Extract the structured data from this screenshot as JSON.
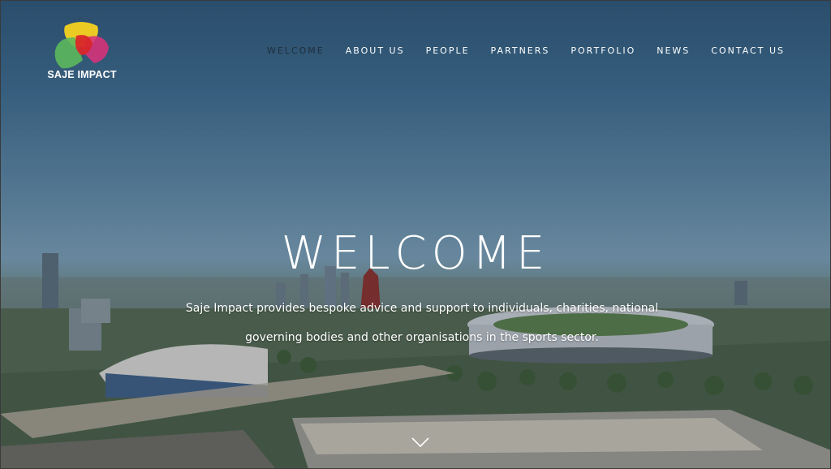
{
  "brand": {
    "name": "SAJE IMPACT"
  },
  "nav": {
    "items": [
      {
        "label": "WELCOME",
        "active": true
      },
      {
        "label": "ABOUT US"
      },
      {
        "label": "PEOPLE"
      },
      {
        "label": "PARTNERS"
      },
      {
        "label": "PORTFOLIO"
      },
      {
        "label": "NEWS"
      },
      {
        "label": "CONTACT US"
      }
    ]
  },
  "hero": {
    "title": "WELCOME",
    "subtitle": "Saje Impact provides bespoke advice and support to individuals, charities, national governing bodies and other organisations in the sports sector.",
    "scroll_icon": "chevron-down-icon"
  },
  "colors": {
    "logo_yellow": "#f5d21f",
    "logo_red": "#d9262a",
    "logo_green": "#5cb85c",
    "logo_magenta": "#d6337a",
    "nav_active": "#1e2e3c"
  }
}
